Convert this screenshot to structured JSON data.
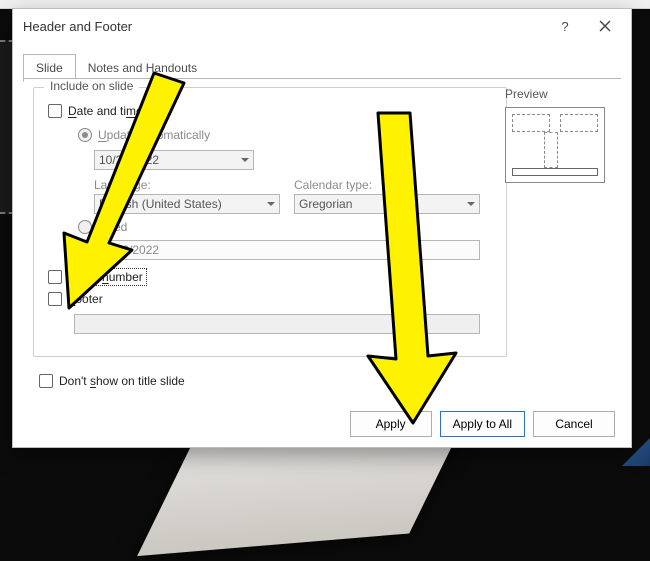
{
  "dialog": {
    "title": "Header and Footer",
    "help_tooltip": "?",
    "close_tooltip": "Close"
  },
  "tabs": {
    "slide": "Slide",
    "notes": "Notes and Handouts"
  },
  "group": {
    "legend": "Include on slide",
    "date_time": "Date and time",
    "update_auto": "Update automatically",
    "date_value": "10/22/2022",
    "language_label": "Language:",
    "language_value": "English (United States)",
    "calendar_label": "Calendar type:",
    "calendar_value": "Gregorian",
    "fixed": "Fixed",
    "fixed_value": "10/22/2022",
    "slide_number": "Slide number",
    "footer_label": "Footer",
    "footer_value": ""
  },
  "titleslide": "Don't show on title slide",
  "preview": {
    "label": "Preview"
  },
  "buttons": {
    "apply": "Apply",
    "apply_all": "Apply to All",
    "cancel": "Cancel"
  }
}
